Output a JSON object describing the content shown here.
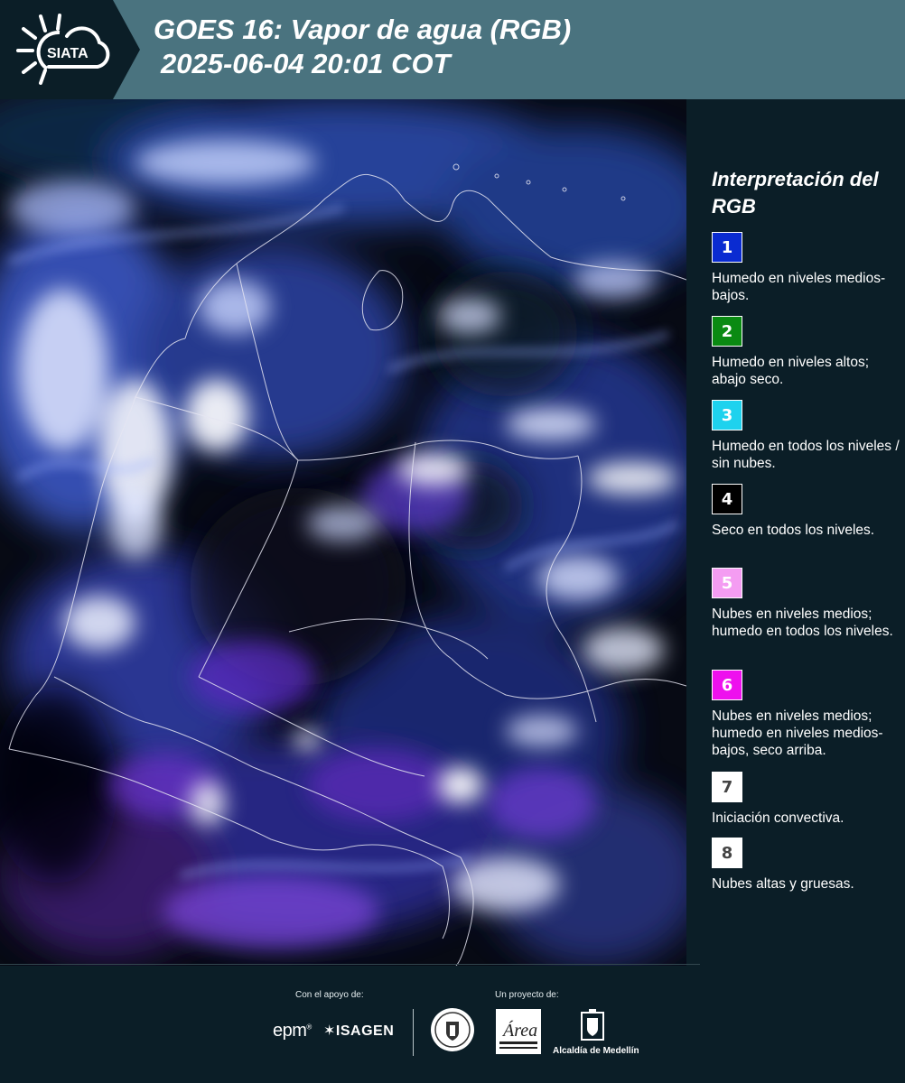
{
  "header": {
    "logo_text": "SIATA",
    "title_line1": "GOES 16: Vapor de agua (RGB)",
    "title_line2": "2025-06-04 20:01 COT",
    "header_color": "#4a737f",
    "logo_plate_color": "#0b1e27"
  },
  "legend": {
    "title": "Interpretación del RGB",
    "items": [
      {
        "number": "1",
        "color": "#0a2bd1",
        "text": "Humedo en niveles medios-bajos."
      },
      {
        "number": "2",
        "color": "#0a8a12",
        "text": "Humedo en niveles altos; abajo seco."
      },
      {
        "number": "3",
        "color": "#1ed2ee",
        "text": "Humedo en todos los niveles / sin nubes."
      },
      {
        "number": "4",
        "color": "#000000",
        "text": "Seco en todos los niveles."
      },
      {
        "number": "5",
        "color": "#f49cf2",
        "text": "Nubes en niveles medios; humedo en todos los niveles."
      },
      {
        "number": "6",
        "color": "#ee10ee",
        "text": "Nubes en niveles medios; humedo en niveles medios-bajos, seco arriba."
      },
      {
        "number": "7",
        "color": "#ffffff",
        "text": "Iniciación convectiva."
      },
      {
        "number": "8",
        "color": "#ffffff",
        "text": "Nubes altas y gruesas."
      }
    ]
  },
  "footer": {
    "support_caption": "Con el apoyo de:",
    "project_caption": "Un proyecto de:",
    "epm_logo": "epm",
    "isagen_logo": "ISAGEN",
    "area_logo": "Área",
    "alcaldia_logo": "Alcaldía de Medellín"
  }
}
